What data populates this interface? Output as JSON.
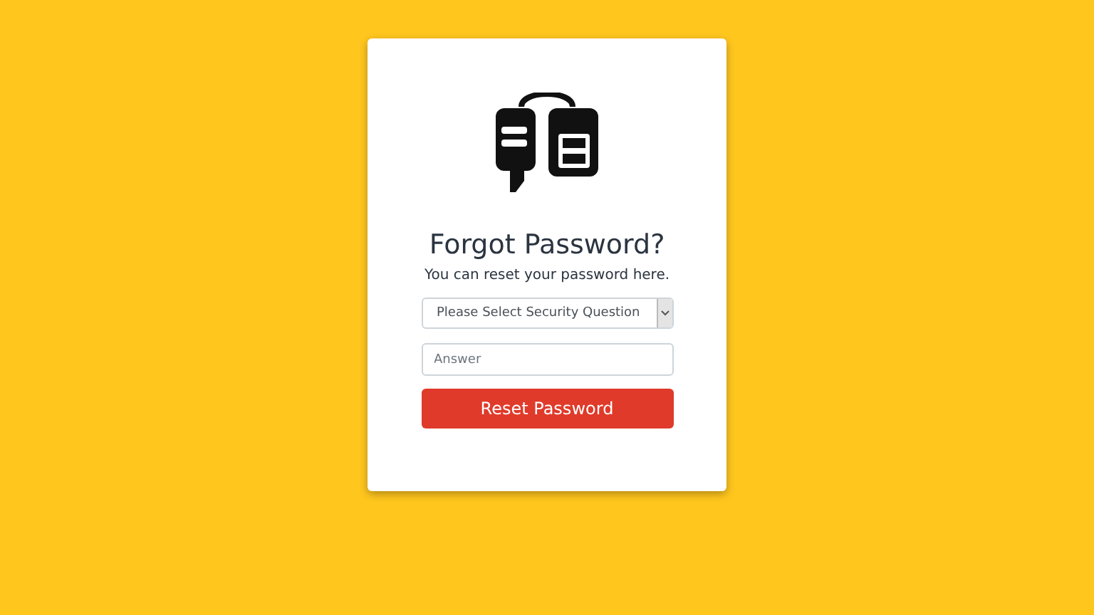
{
  "title": "Forgot Password?",
  "subtitle": "You can reset your password here.",
  "security_question": {
    "value": "Please Select Security Question"
  },
  "answer": {
    "placeholder": "Answer"
  },
  "submit": {
    "label": "Reset Password"
  }
}
